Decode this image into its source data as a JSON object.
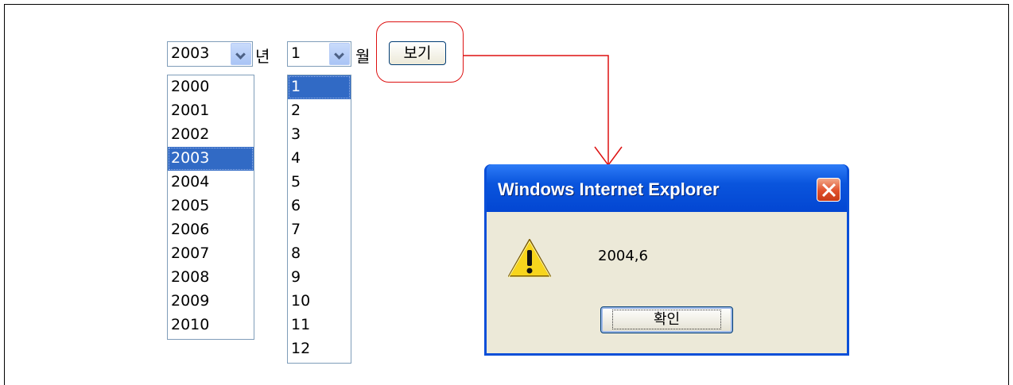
{
  "form": {
    "year_select": {
      "value": "2003",
      "unit_label": "년"
    },
    "month_select": {
      "value": "1",
      "unit_label": "월"
    },
    "view_button_label": "보기",
    "year_options": [
      "2000",
      "2001",
      "2002",
      "2003",
      "2004",
      "2005",
      "2006",
      "2007",
      "2008",
      "2009",
      "2010"
    ],
    "year_selected_index": 3,
    "month_options": [
      "1",
      "2",
      "3",
      "4",
      "5",
      "6",
      "7",
      "8",
      "9",
      "10",
      "11",
      "12"
    ],
    "month_selected_index": 0
  },
  "dialog": {
    "title": "Windows Internet Explorer",
    "message": "2004,6",
    "ok_label": "확인",
    "icon": "warning-icon",
    "close_icon": "close-icon"
  },
  "colors": {
    "highlight": "#dd1111",
    "selection": "#316ac5",
    "titlebar": "#0a55dd"
  }
}
